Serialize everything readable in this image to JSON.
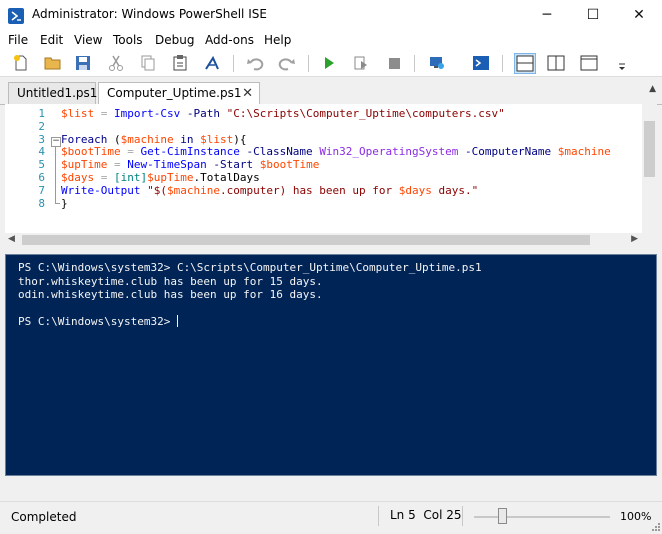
{
  "window": {
    "title": "Administrator: Windows PowerShell ISE",
    "controls": {
      "minimize": "─",
      "maximize": "☐",
      "close": "✕"
    }
  },
  "menu": [
    "File",
    "Edit",
    "View",
    "Tools",
    "Debug",
    "Add-ons",
    "Help"
  ],
  "toolbar": {
    "icons": [
      "new-script-icon",
      "open-folder-icon",
      "save-icon",
      "cut-icon",
      "copy-icon",
      "paste-icon",
      "clear-console-icon",
      "undo-icon",
      "redo-icon",
      "run-script-icon",
      "run-selection-icon",
      "stop-icon",
      "new-remote-tab-icon",
      "start-powershell-icon",
      "show-script-top-icon",
      "show-script-right-icon",
      "show-script-maximized-icon",
      "toolbar-overflow-icon"
    ]
  },
  "tabs": [
    {
      "label": "Untitled1.ps1",
      "active": false
    },
    {
      "label": "Computer_Uptime.ps1",
      "active": true,
      "close": "✕"
    }
  ],
  "editor": {
    "line_numbers": [
      "1",
      "2",
      "3",
      "4",
      "5",
      "6",
      "7",
      "8"
    ],
    "lines": [
      [
        {
          "c": "v",
          "t": "$list"
        },
        {
          "c": "x",
          "t": " "
        },
        {
          "c": "o",
          "t": "="
        },
        {
          "c": "x",
          "t": " "
        },
        {
          "c": "c",
          "t": "Import-Csv"
        },
        {
          "c": "x",
          "t": " "
        },
        {
          "c": "p",
          "t": "-Path"
        },
        {
          "c": "x",
          "t": " "
        },
        {
          "c": "s",
          "t": "\"C:\\Scripts\\Computer_Uptime\\computers.csv\""
        }
      ],
      [],
      [
        {
          "c": "k",
          "t": "Foreach"
        },
        {
          "c": "x",
          "t": " ("
        },
        {
          "c": "v",
          "t": "$machine"
        },
        {
          "c": "x",
          "t": " "
        },
        {
          "c": "k",
          "t": "in"
        },
        {
          "c": "x",
          "t": " "
        },
        {
          "c": "v",
          "t": "$list"
        },
        {
          "c": "x",
          "t": "){"
        }
      ],
      [
        {
          "c": "v",
          "t": "$bootTime"
        },
        {
          "c": "x",
          "t": " "
        },
        {
          "c": "o",
          "t": "="
        },
        {
          "c": "x",
          "t": " "
        },
        {
          "c": "c",
          "t": "Get-CimInstance"
        },
        {
          "c": "x",
          "t": " "
        },
        {
          "c": "p",
          "t": "-ClassName"
        },
        {
          "c": "x",
          "t": " "
        },
        {
          "c": "a",
          "t": "Win32_OperatingSystem"
        },
        {
          "c": "x",
          "t": " "
        },
        {
          "c": "p",
          "t": "-ComputerName"
        },
        {
          "c": "x",
          "t": " "
        },
        {
          "c": "v",
          "t": "$machine"
        }
      ],
      [
        {
          "c": "v",
          "t": "$upTime"
        },
        {
          "c": "x",
          "t": " "
        },
        {
          "c": "o",
          "t": "="
        },
        {
          "c": "x",
          "t": " "
        },
        {
          "c": "c",
          "t": "New-TimeSpan"
        },
        {
          "c": "x",
          "t": " "
        },
        {
          "c": "p",
          "t": "-Start"
        },
        {
          "c": "x",
          "t": " "
        },
        {
          "c": "v",
          "t": "$bootTime"
        }
      ],
      [
        {
          "c": "v",
          "t": "$days"
        },
        {
          "c": "x",
          "t": " "
        },
        {
          "c": "o",
          "t": "="
        },
        {
          "c": "x",
          "t": " "
        },
        {
          "c": "t",
          "t": "[int]"
        },
        {
          "c": "v",
          "t": "$upTime"
        },
        {
          "c": "x",
          "t": "."
        },
        {
          "c": "x",
          "t": "TotalDays"
        }
      ],
      [
        {
          "c": "c",
          "t": "Write-Output"
        },
        {
          "c": "x",
          "t": " "
        },
        {
          "c": "s",
          "t": "\"$("
        },
        {
          "c": "v",
          "t": "$machine"
        },
        {
          "c": "s",
          "t": ".computer) has been up for "
        },
        {
          "c": "v",
          "t": "$days"
        },
        {
          "c": "s",
          "t": " days.\""
        }
      ],
      [
        {
          "c": "x",
          "t": "}"
        }
      ]
    ]
  },
  "console": {
    "lines": [
      "PS C:\\Windows\\system32> C:\\Scripts\\Computer_Uptime\\Computer_Uptime.ps1",
      "thor.whiskeytime.club has been up for 15 days.",
      "odin.whiskeytime.club has been up for 16 days.",
      "",
      "PS C:\\Windows\\system32> "
    ]
  },
  "status": {
    "text": "Completed",
    "line": "Ln 5",
    "column": "Col 25",
    "zoom": "100%"
  },
  "colors": {
    "console_background": "#012456",
    "cmdlet": "#0000ff",
    "variable": "#ff4500",
    "parameter": "#000080",
    "string": "#8b0000",
    "line_number": "#2b91af"
  }
}
